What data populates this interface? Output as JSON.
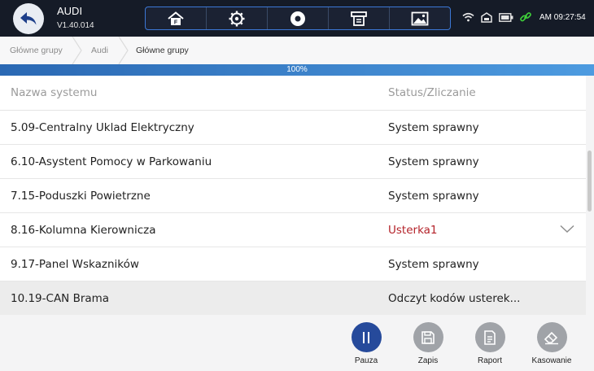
{
  "header": {
    "title": "AUDI",
    "version": "V1.40.014",
    "time": "AM 09:27:54",
    "toolbar": [
      "home-icon",
      "settings-icon",
      "record-icon",
      "print-icon",
      "image-icon"
    ]
  },
  "breadcrumb": [
    "Główne grupy",
    "Audi",
    "Główne grupy"
  ],
  "progress": {
    "label": "100%",
    "value": 100
  },
  "table": {
    "headers": {
      "name": "Nazwa systemu",
      "status": "Status/Zliczanie"
    },
    "rows": [
      {
        "name": "5.09-Centralny Uklad Elektryczny",
        "status": "System sprawny"
      },
      {
        "name": "6.10-Asystent Pomocy w Parkowaniu",
        "status": "System sprawny"
      },
      {
        "name": "7.15-Poduszki Powietrzne",
        "status": "System sprawny"
      },
      {
        "name": "8.16-Kolumna Kierownicza",
        "status": "Usterka1"
      },
      {
        "name": "9.17-Panel Wskazników",
        "status": "System sprawny"
      },
      {
        "name": "10.19-CAN Brama",
        "status": "Odczyt kodów usterek..."
      }
    ]
  },
  "actions": {
    "pause": "Pauza",
    "save": "Zapis",
    "report": "Raport",
    "erase": "Kasowanie"
  },
  "colors": {
    "accent": "#264a9b",
    "fault": "#b4232a",
    "topbar": "#151b27"
  }
}
